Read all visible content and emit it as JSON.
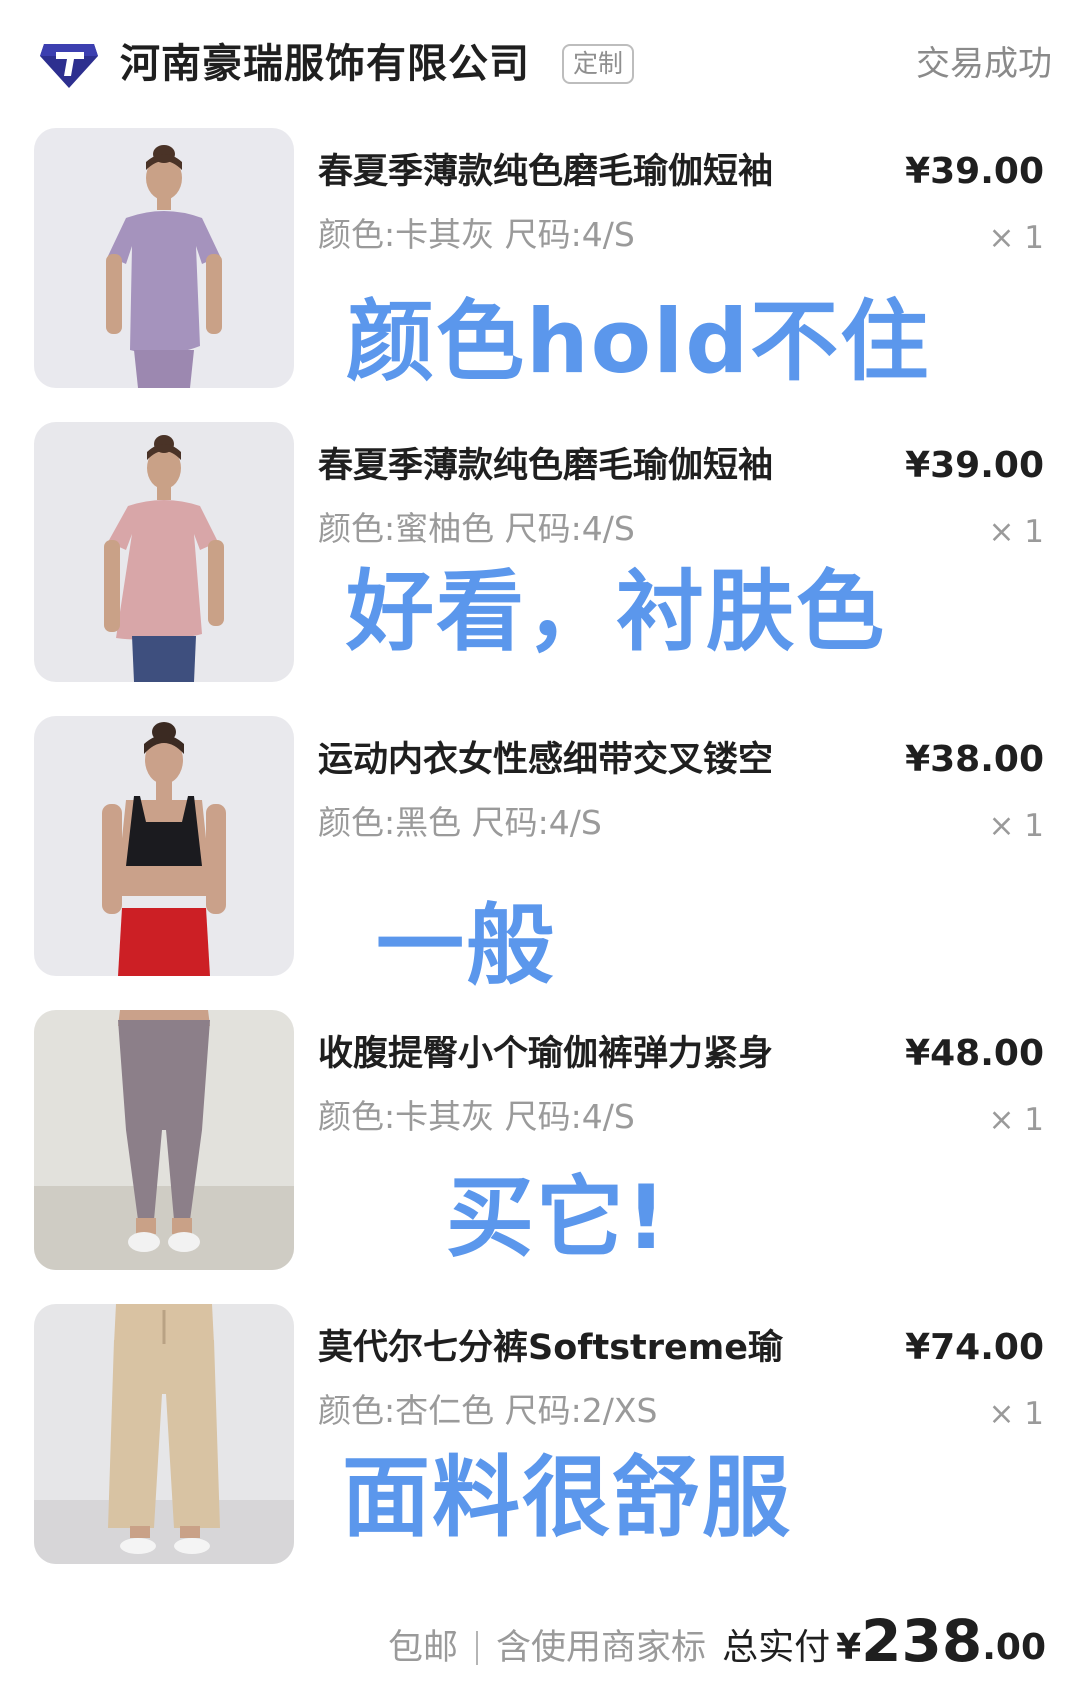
{
  "shop": {
    "name": "河南豪瑞服饰有限公司",
    "tag": "定制",
    "status": "交易成功",
    "logo_icon": "diamond-logo-icon"
  },
  "items": [
    {
      "title": "春夏季薄款纯色磨毛瑜伽短袖",
      "spec": "颜色:卡其灰 尺码:4/S",
      "price": "¥39.00",
      "qty": "× 1",
      "review": "颜色hold不住",
      "image": "lilac-yoga-tshirt"
    },
    {
      "title": "春夏季薄款纯色磨毛瑜伽短袖",
      "spec": "颜色:蜜柚色 尺码:4/S",
      "price": "¥39.00",
      "qty": "× 1",
      "review": "好看，衬肤色",
      "image": "pink-yoga-tshirt"
    },
    {
      "title": "运动内衣女性感细带交叉镂空",
      "spec": "颜色:黑色 尺码:4/S",
      "price": "¥38.00",
      "qty": "× 1",
      "review": "一般",
      "image": "black-sports-bra"
    },
    {
      "title": "收腹提臀小个瑜伽裤弹力紧身",
      "spec": "颜色:卡其灰 尺码:4/S",
      "price": "¥48.00",
      "qty": "× 1",
      "review": "买它!",
      "image": "grey-yoga-leggings"
    },
    {
      "title": "莫代尔七分裤Softstreme瑜",
      "spec": "颜色:杏仁色 尺码:2/XS",
      "price": "¥74.00",
      "qty": "× 1",
      "review": "面料很舒服",
      "image": "almond-cropped-pants"
    }
  ],
  "footer": {
    "shipping": "包邮",
    "brand_note": "含使用商家标",
    "total_label": "总实付",
    "total_currency": "¥",
    "total_integer": "238",
    "total_decimal": ".00"
  },
  "colors": {
    "review_text": "#5b97ec",
    "primary_text": "#1f1f1f",
    "secondary_text": "#9a9a9a"
  }
}
